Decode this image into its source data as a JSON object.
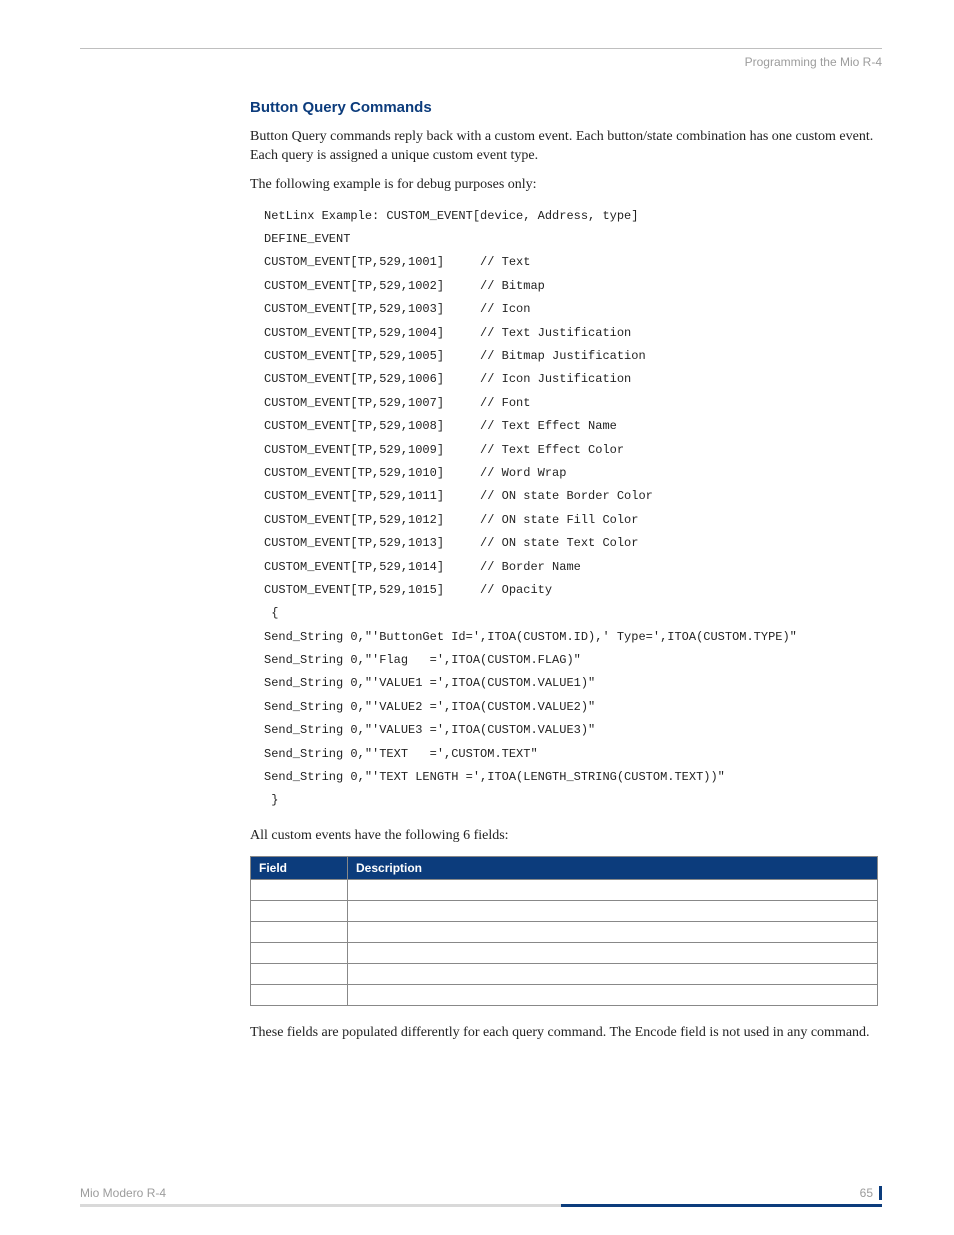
{
  "header": {
    "breadcrumb": "Programming the Mio R-4"
  },
  "section": {
    "title": "Button Query Commands",
    "intro": "Button Query commands reply back with a custom event.  Each button/state combination has one custom event. Each query is assigned a unique custom event type.",
    "example_lead": "The following example is for debug purposes only:"
  },
  "code": "NetLinx Example: CUSTOM_EVENT[device, Address, type]\nDEFINE_EVENT\nCUSTOM_EVENT[TP,529,1001]     // Text\nCUSTOM_EVENT[TP,529,1002]     // Bitmap\nCUSTOM_EVENT[TP,529,1003]     // Icon\nCUSTOM_EVENT[TP,529,1004]     // Text Justification\nCUSTOM_EVENT[TP,529,1005]     // Bitmap Justification\nCUSTOM_EVENT[TP,529,1006]     // Icon Justification\nCUSTOM_EVENT[TP,529,1007]     // Font\nCUSTOM_EVENT[TP,529,1008]     // Text Effect Name\nCUSTOM_EVENT[TP,529,1009]     // Text Effect Color\nCUSTOM_EVENT[TP,529,1010]     // Word Wrap\nCUSTOM_EVENT[TP,529,1011]     // ON state Border Color\nCUSTOM_EVENT[TP,529,1012]     // ON state Fill Color\nCUSTOM_EVENT[TP,529,1013]     // ON state Text Color\nCUSTOM_EVENT[TP,529,1014]     // Border Name\nCUSTOM_EVENT[TP,529,1015]     // Opacity\n {\nSend_String 0,\"'ButtonGet Id=',ITOA(CUSTOM.ID),' Type=',ITOA(CUSTOM.TYPE)\"\nSend_String 0,\"'Flag   =',ITOA(CUSTOM.FLAG)\"\nSend_String 0,\"'VALUE1 =',ITOA(CUSTOM.VALUE1)\"\nSend_String 0,\"'VALUE2 =',ITOA(CUSTOM.VALUE2)\"\nSend_String 0,\"'VALUE3 =',ITOA(CUSTOM.VALUE3)\"\nSend_String 0,\"'TEXT   =',CUSTOM.TEXT\"\nSend_String 0,\"'TEXT LENGTH =',ITOA(LENGTH_STRING(CUSTOM.TEXT))\"\n }",
  "after_code": "All custom events have the following 6 fields:",
  "table": {
    "headers": {
      "field": "Field",
      "description": "Description"
    },
    "rows": [
      {
        "field": "",
        "description": ""
      },
      {
        "field": "",
        "description": ""
      },
      {
        "field": "",
        "description": ""
      },
      {
        "field": "",
        "description": ""
      },
      {
        "field": "",
        "description": ""
      },
      {
        "field": "",
        "description": ""
      }
    ]
  },
  "closing": "These fields are populated differently for each query command.  The Encode field is not used in any command.",
  "footer": {
    "doc": "Mio Modero R-4",
    "page": "65"
  }
}
